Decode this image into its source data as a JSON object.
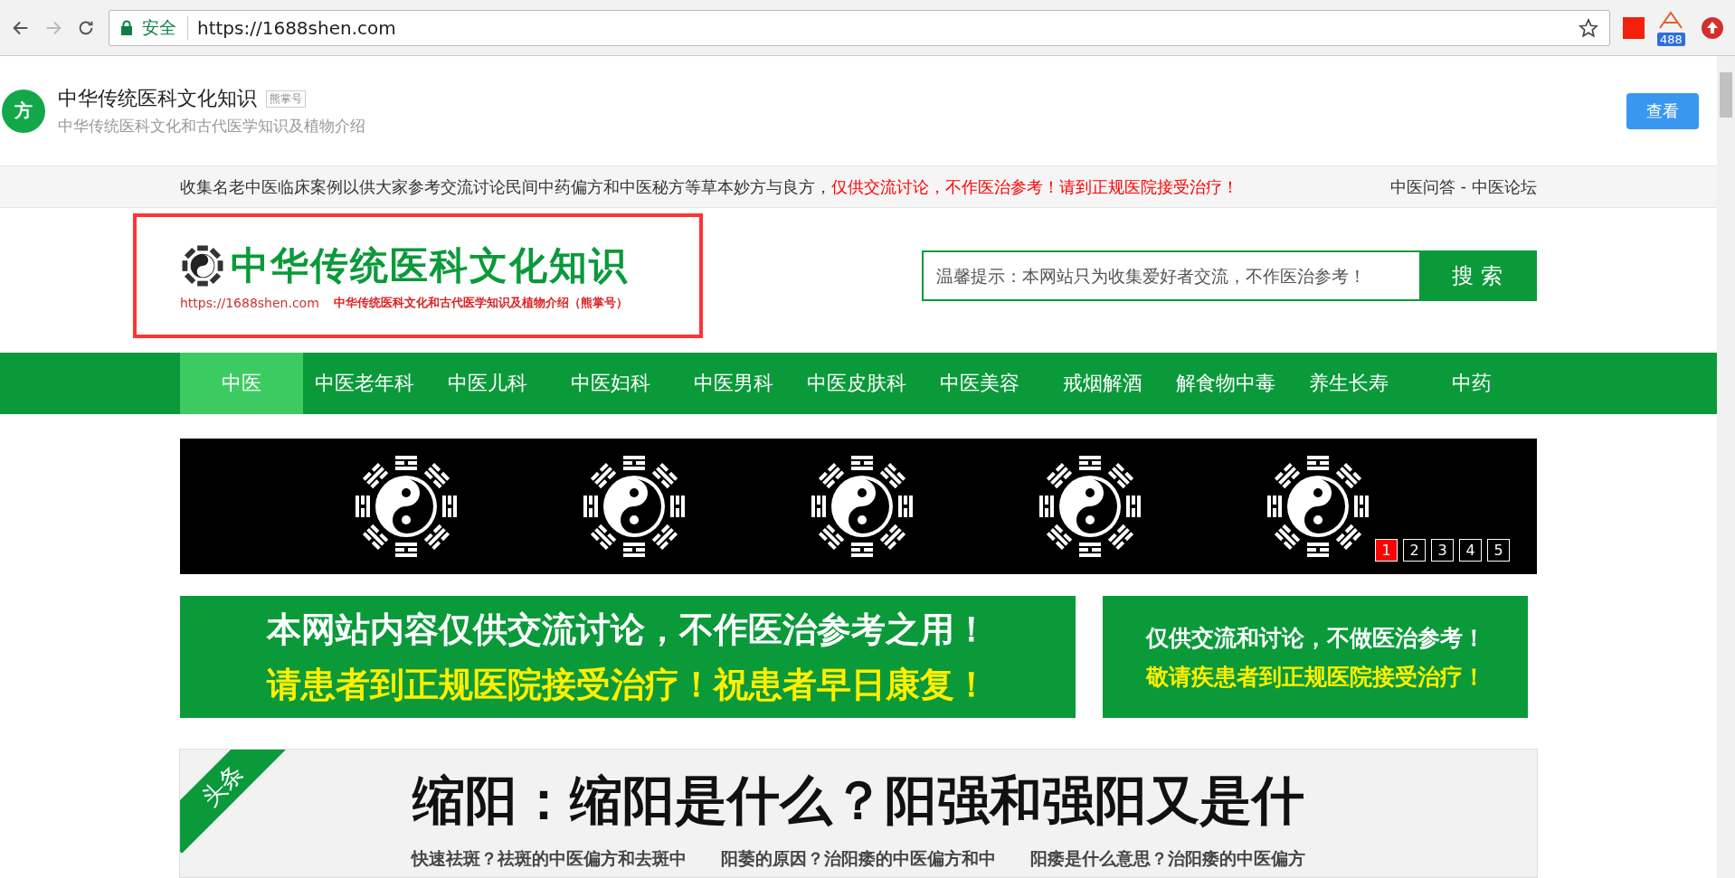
{
  "browser": {
    "secure_label": "安全",
    "url": "https://1688shen.com",
    "extension_badge": "488"
  },
  "profile": {
    "avatar_text": "方",
    "name": "中华传统医科文化知识",
    "tag": "熊掌号",
    "description": "中华传统医科文化和古代医学知识及植物介绍",
    "button": "查看"
  },
  "notice": {
    "text": "收集名老中医临床案例以供大家参考交流讨论民间中药偏方和中医秘方等草本妙方与良方，",
    "warning": "仅供交流讨论，不作医治参考！请到正规医院接受治疗！",
    "links": [
      "中医问答",
      "中医论坛"
    ],
    "separator": "-"
  },
  "logo": {
    "title": "中华传统医科文化知识",
    "url": "https://1688shen.com",
    "subtitle": "中华传统医科文化和古代医学知识及植物介绍（熊掌号）"
  },
  "search": {
    "placeholder": "温馨提示：本网站只为收集爱好者交流，不作医治参考！",
    "button": "搜 索"
  },
  "nav": [
    {
      "label": "中医",
      "selected": true
    },
    {
      "label": "中医老年科",
      "selected": false
    },
    {
      "label": "中医儿科",
      "selected": false
    },
    {
      "label": "中医妇科",
      "selected": false
    },
    {
      "label": "中医男科",
      "selected": false
    },
    {
      "label": "中医皮肤科",
      "selected": false
    },
    {
      "label": "中医美容",
      "selected": false
    },
    {
      "label": "戒烟解酒",
      "selected": false
    },
    {
      "label": "解食物中毒",
      "selected": false
    },
    {
      "label": "养生长寿",
      "selected": false
    },
    {
      "label": "中药",
      "selected": false
    }
  ],
  "slider": {
    "pages": [
      {
        "label": "1",
        "selected": true
      },
      {
        "label": "2",
        "selected": false
      },
      {
        "label": "3",
        "selected": false
      },
      {
        "label": "4",
        "selected": false
      },
      {
        "label": "5",
        "selected": false
      }
    ]
  },
  "banners": [
    {
      "line_1": "本网站内容仅供交流讨论，不作医治参考之用！",
      "line_2": "请患者到正规医院接受治疗！祝患者早日康复！"
    },
    {
      "line_1": "仅供交流和讨论，不做医治参考！",
      "line_2": "敬请疾患者到正规医院接受治疗！"
    }
  ],
  "headline": {
    "ribbon": "头条",
    "title": "缩阳：缩阳是什么？阳强和强阳又是什",
    "links": [
      "快速祛斑？祛斑的中医偏方和去斑中",
      "阳萎的原因？治阳痿的中医偏方和中",
      "阳痿是什么意思？治阳痿的中医偏方"
    ]
  }
}
